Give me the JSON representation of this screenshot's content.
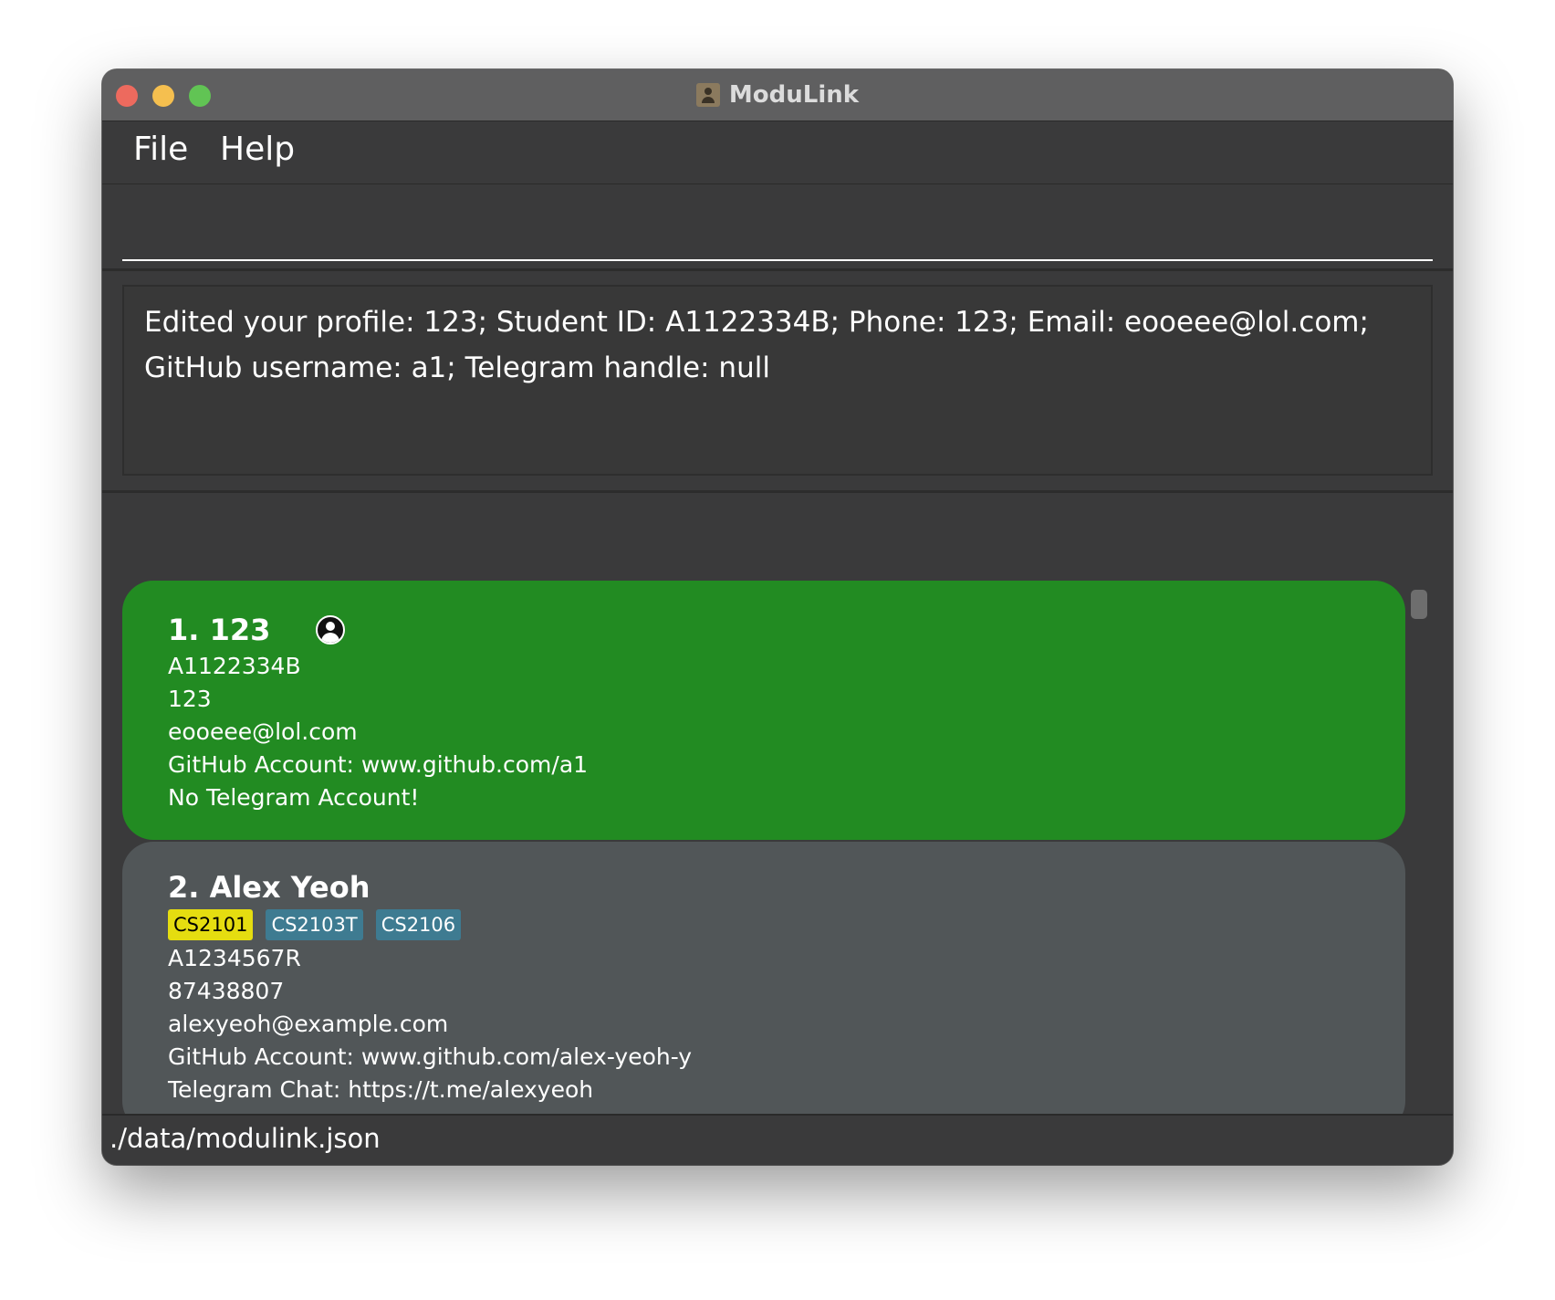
{
  "window": {
    "title": "ModuLink"
  },
  "menu": {
    "file": "File",
    "help": "Help"
  },
  "command_box": {
    "value": "",
    "placeholder": ""
  },
  "result": {
    "line1": "Edited your profile: 123; Student ID: A1122334B; Phone: 123; Email: eooeee@lol.com;",
    "line2": "GitHub username: a1; Telegram handle: null"
  },
  "persons": [
    {
      "index_name": "1. 123",
      "is_profile": true,
      "tags": [],
      "student_id": "A1122334B",
      "phone": "123",
      "email": "eooeee@lol.com",
      "github": "GitHub Account: www.github.com/a1",
      "telegram": "No Telegram Account!",
      "card_color": "#228b22"
    },
    {
      "index_name": "2. Alex Yeoh",
      "is_profile": false,
      "tags": [
        {
          "label": "CS2101",
          "color": "#e5dd10"
        },
        {
          "label": "CS2103T",
          "color": "#3e7b91"
        },
        {
          "label": "CS2106",
          "color": "#3e7b91"
        }
      ],
      "student_id": "A1234567R",
      "phone": "87438807",
      "email": "alexyeoh@example.com",
      "github": "GitHub Account: www.github.com/alex-yeoh-y",
      "telegram": "Telegram Chat: https://t.me/alexyeoh",
      "card_color": "#515658"
    }
  ],
  "status_bar": {
    "path": "./data/modulink.json"
  },
  "icons": {
    "window_close": "close-traffic-light-icon",
    "window_minimize": "minimize-traffic-light-icon",
    "window_zoom": "zoom-traffic-light-icon",
    "app": "address-book-icon",
    "profile": "user-profile-icon"
  },
  "colors": {
    "background": "#3a3a3b",
    "profile_card": "#228b22",
    "contact_card": "#515658",
    "tag_highlight": "#e5dd10",
    "tag_default": "#3e7b91"
  }
}
